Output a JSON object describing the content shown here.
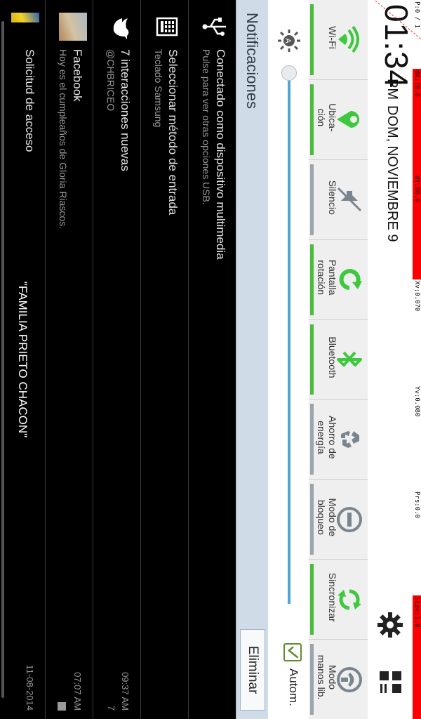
{
  "debug": {
    "p": "P:0 / 1",
    "dx": "dX:70.0",
    "dy": "dY:80.0",
    "xv": "Xv:0.070",
    "yv": "Yv:0.080",
    "prs": "Prs:0.0",
    "size": "Size:1.0"
  },
  "header": {
    "time": "01:34",
    "ampm": "PM",
    "date": "DOM, NOVIEMBRE 9",
    "settings_icon": "gear-icon",
    "apps_icon": "grid-icon"
  },
  "toggles": [
    {
      "label": "Wi-Fi",
      "icon": "wifi-icon",
      "on": true
    },
    {
      "label": "Ubica-\nción",
      "icon": "location-icon",
      "on": true
    },
    {
      "label": "Silencio",
      "icon": "mute-icon",
      "on": false
    },
    {
      "label": "Pantalla\nrotación",
      "icon": "rotation-icon",
      "on": true
    },
    {
      "label": "Bluetooth",
      "icon": "bluetooth-icon",
      "on": true
    },
    {
      "label": "Ahorro de\nenergía",
      "icon": "recycle-icon",
      "on": false
    },
    {
      "label": "Modo de\nbloqueo",
      "icon": "block-icon",
      "on": false
    },
    {
      "label": "Sincronizar",
      "icon": "sync-icon",
      "on": true
    },
    {
      "label": "Modo\nmanos lib.",
      "icon": "handsfree-icon",
      "on": false
    }
  ],
  "brightness": {
    "level": 0.0,
    "auto_label": "Autom.",
    "auto_checked": true
  },
  "notifications": {
    "title": "Notificaciones",
    "clear_label": "Eliminar",
    "items": [
      {
        "title": "Conectado como dispositivo multimedia",
        "text": "Pulse para ver otras opciones USB.",
        "time": "",
        "count": ""
      },
      {
        "title": "Seleccionar método de entrada",
        "text": "Teclado Samsung",
        "time": "",
        "count": ""
      },
      {
        "title": "7 interacciones nuevas",
        "text": "@CHBRICEO",
        "time": "09:37 AM",
        "count": "7"
      },
      {
        "title": "Facebook",
        "text": "Hoy es el cumpleaños de Gloria Riascos.",
        "time": "07:07 AM",
        "count": ""
      },
      {
        "title": "Solicitud de acceso",
        "text": "",
        "time": "11-08-2014",
        "count": ""
      }
    ],
    "footer": "\"FAMILIA PRIETO CHACON\""
  },
  "colors": {
    "on": "#4cbc3c",
    "off": "#9aa5ae",
    "accent": "#4ea6d6",
    "debug_red": "#ff0000"
  }
}
